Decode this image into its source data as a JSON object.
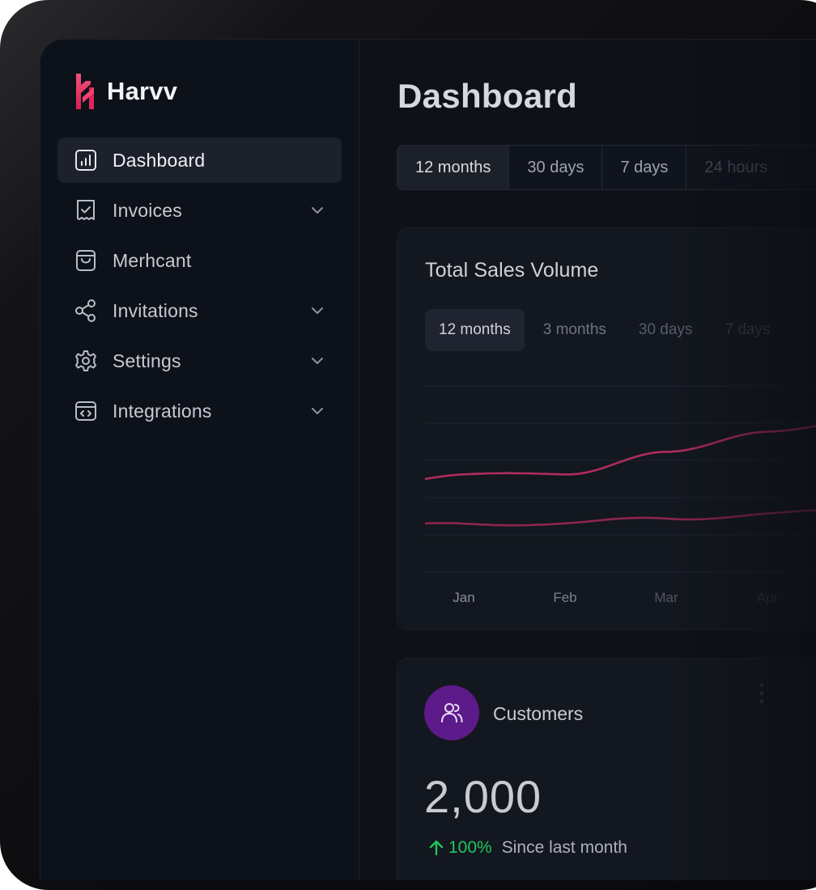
{
  "brand": {
    "name": "Harvv",
    "accent": "#e83a6d"
  },
  "sidebar": {
    "items": [
      {
        "label": "Dashboard",
        "icon": "bar-chart-icon",
        "active": true,
        "expandable": false
      },
      {
        "label": "Invoices",
        "icon": "receipt-icon",
        "active": false,
        "expandable": true
      },
      {
        "label": "Merhcant",
        "icon": "shopping-bag-icon",
        "active": false,
        "expandable": false
      },
      {
        "label": "Invitations",
        "icon": "share-icon",
        "active": false,
        "expandable": true
      },
      {
        "label": "Settings",
        "icon": "gear-icon",
        "active": false,
        "expandable": true
      },
      {
        "label": "Integrations",
        "icon": "code-window-icon",
        "active": false,
        "expandable": true
      }
    ]
  },
  "main": {
    "title": "Dashboard",
    "range_filter": {
      "options": [
        "12 months",
        "30 days",
        "7 days",
        "24 hours"
      ],
      "selected": "12 months"
    }
  },
  "sales_card": {
    "title": "Total Sales Volume",
    "tabs": [
      "12 months",
      "3 months",
      "30 days",
      "7 days"
    ],
    "selected_tab": "12 months"
  },
  "chart_data": {
    "type": "line",
    "title": "Total Sales Volume",
    "x": [
      "Jan",
      "Feb",
      "Mar",
      "Apr"
    ],
    "grid": true,
    "series": [
      {
        "color": "#b02c5f",
        "values": [
          50,
          55,
          62,
          78
        ]
      },
      {
        "color": "#8e2550",
        "values": [
          25,
          27,
          28,
          32
        ]
      }
    ],
    "ylim": [
      0,
      100
    ]
  },
  "customers_card": {
    "label": "Customers",
    "icon": "users-icon",
    "value": "2,000",
    "change_icon": "arrow-up-icon",
    "change_pct": "100%",
    "change_label": "Since last month",
    "change_color": "#22c55e",
    "icon_bg": "#5d1a8a"
  }
}
